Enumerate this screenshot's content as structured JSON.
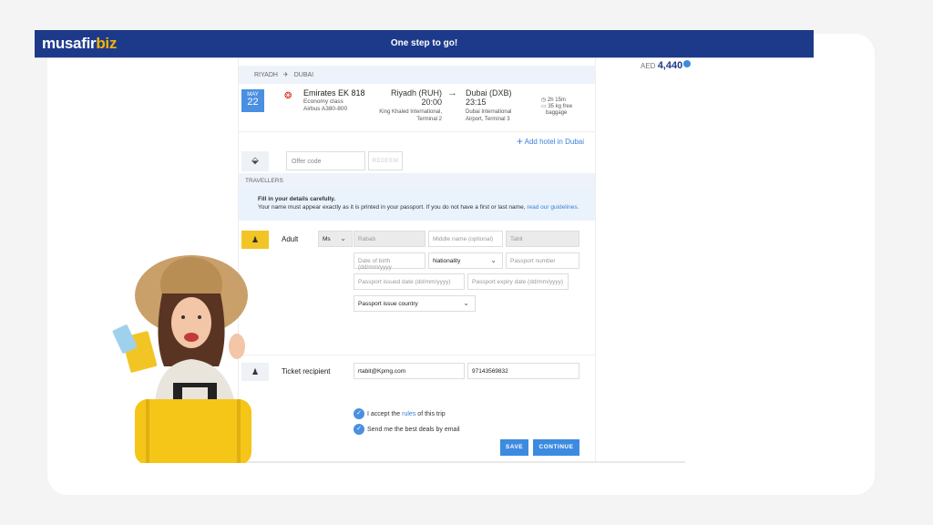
{
  "brand": {
    "musafir": "musafir",
    "biz": "biz"
  },
  "header": {
    "tagline": "One step to go!"
  },
  "price": {
    "currency": "AED",
    "amount": "4,440"
  },
  "route": {
    "from": "RIYADH",
    "to": "DUBAI"
  },
  "flight": {
    "month": "MAY",
    "day": "22",
    "name": "Emirates EK 818",
    "class": "Economy class",
    "aircraft": "Airbus A380-800",
    "dep_city": "Riyadh (RUH)",
    "dep_time": "20:00",
    "dep_airport1": "King Khaled International,",
    "dep_airport2": "Terminal 2",
    "arr_city": "Dubai (DXB)",
    "arr_time": "23:15",
    "arr_airport1": "Dubai International",
    "arr_airport2": "Airport, Terminal 3",
    "duration": "2h 15m",
    "baggage1": "35 kg free",
    "baggage2": "baggage"
  },
  "hotel_link": "Add hotel in Dubai",
  "offer": {
    "placeholder": "Offer code",
    "redeem": "REDEEM"
  },
  "travellers": {
    "heading": "TRAVELLERS",
    "notice_bold": "Fill in your details carefully.",
    "notice": "Your name must appear exactly as it is printed in your passport. If you do not have a first or last name,",
    "notice_link": "read our guidelines."
  },
  "adult": {
    "label": "Adult",
    "title": "Ms",
    "first": "Rabab",
    "middle": "Middle name (optional)",
    "last": "Tabit",
    "dob": "Date of birth (dd/mm/yyyy",
    "nationality": "Nationality",
    "passport": "Passport number",
    "issued": "Passport issued date (dd/mm/yyyy)",
    "expiry": "Passport expiry date (dd/mm/yyyy)",
    "issue_country": "Passport issue country"
  },
  "recipient": {
    "label": "Ticket recipient",
    "email": "rtabit@Kpmg.com",
    "phone": "97143569832"
  },
  "consent": {
    "accept_pre": "I accept the",
    "accept_link": "rules",
    "accept_post": "of this trip",
    "deals": "Send me the best deals by email"
  },
  "buttons": {
    "save": "SAVE",
    "continue": "CONTINUE"
  }
}
